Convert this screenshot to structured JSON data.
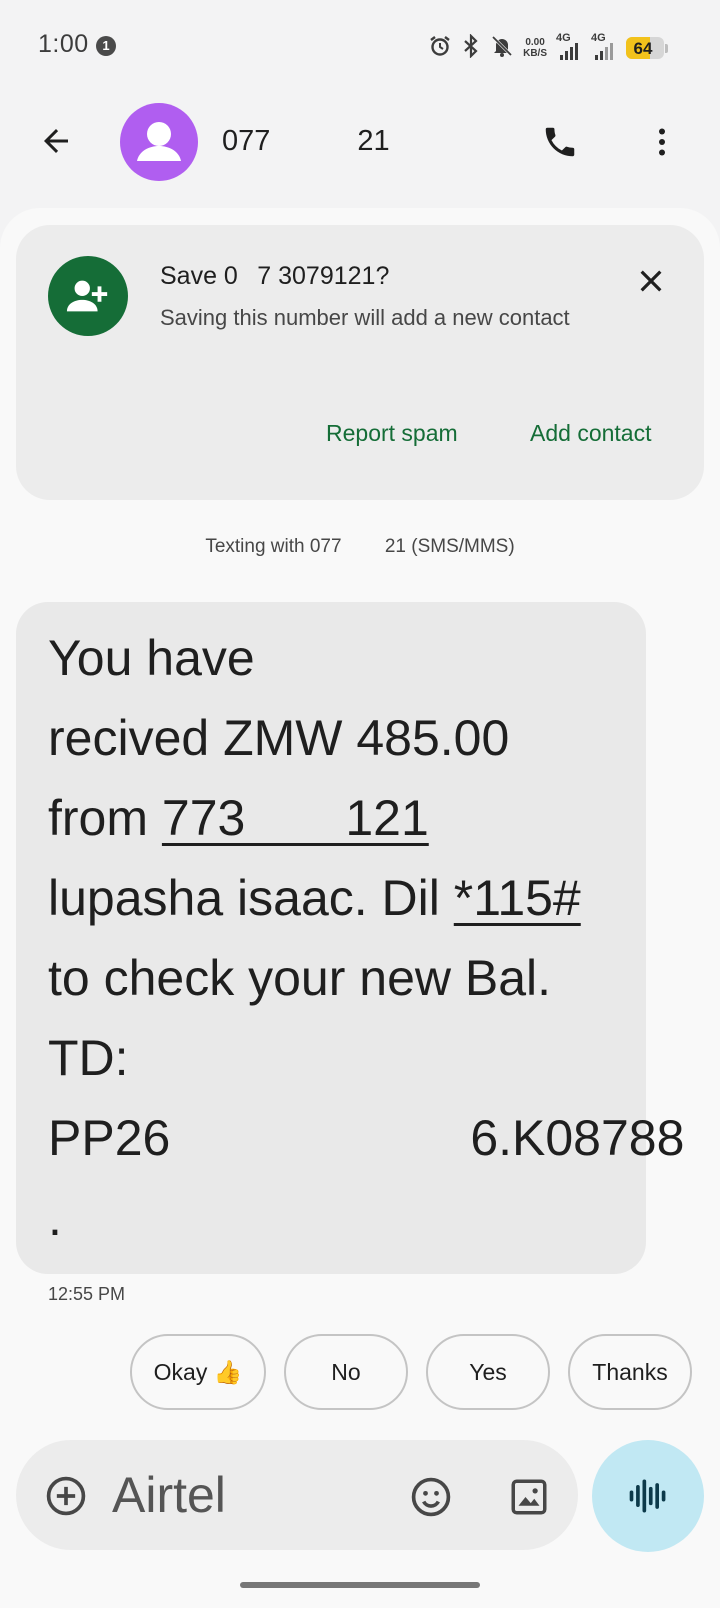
{
  "status_bar": {
    "time": "1:00",
    "notification_count": "1",
    "net_speed_value": "0.00",
    "net_speed_unit": "KB/S",
    "sim1_label": "4G",
    "sim2_label": "4G",
    "battery_percent": "64",
    "battery_level": 0.64
  },
  "header": {
    "contact_title": "077   21"
  },
  "save_card": {
    "title": "Save 0  7 3079121?",
    "subtitle": "Saving this number will add a new contact",
    "report_spam_label": "Report spam",
    "add_contact_label": "Add contact"
  },
  "conversation": {
    "texting_with": "Texting with 077   21 (SMS/MMS)",
    "message": {
      "line1": "You have",
      "line2": "recived ZMW 485.00",
      "line3_prefix": "from ",
      "line3_link": "773  121",
      "line4_prefix": "lupasha isaac. Dil ",
      "line4_link": "*115#",
      "line5": "to check your new Bal.",
      "line6": "TD:",
      "line7": "PP26      6.K08788",
      "line8": "."
    },
    "time": "12:55 PM"
  },
  "smart_replies": [
    "Okay 👍",
    "No",
    "Yes",
    "Thanks"
  ],
  "compose": {
    "placeholder": "Airtel"
  },
  "colors": {
    "accent_green": "#156d37",
    "avatar_purple": "#b05ef0",
    "voice_button": "#c1e8f3"
  }
}
